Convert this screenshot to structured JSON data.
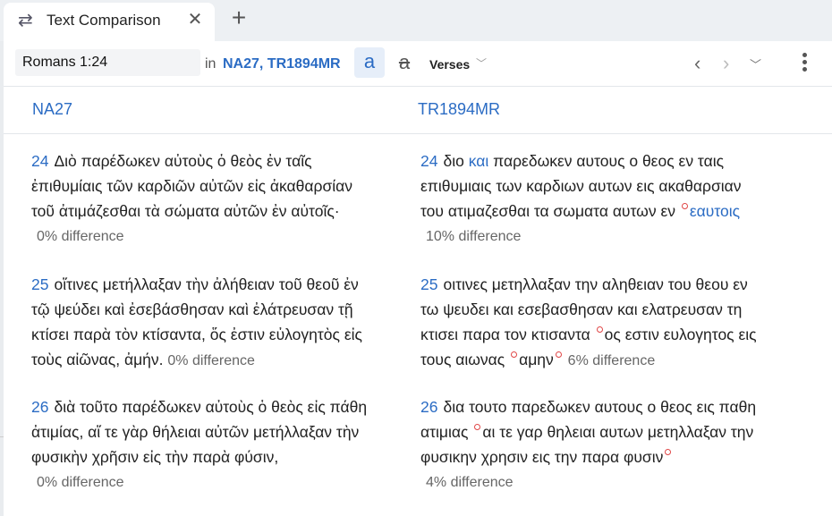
{
  "tab": {
    "title": "Text Comparison",
    "icon": "swap-arrows-icon",
    "close": "✕"
  },
  "new_tab": "+",
  "toolbar": {
    "reference": "Romans 1:24",
    "in_label": "in",
    "versions": "NA27, TR1894MR",
    "btn_a": "a",
    "btn_strike": "a",
    "mode": "Verses"
  },
  "columns": {
    "left": "NA27",
    "right": "TR1894MR"
  },
  "left": [
    {
      "num": "24",
      "lines": [
        "Διὸ παρέδωκεν αὐτοὺς ὁ θεὸς ἐν ταῖς",
        "ἐπιθυμίαις τῶν καρδιῶν αὐτῶν εἰς ἀκαθαρσίαν",
        "τοῦ ἀτιμάζεσθαι τὰ σώματα αὐτῶν ἐν αὐτοῖς·"
      ],
      "diff": "0% difference"
    },
    {
      "num": "25",
      "lines": [
        "οἵτινες μετήλλαξαν τὴν ἀλήθειαν τοῦ θεοῦ ἐν",
        "τῷ ψεύδει καὶ ἐσεβάσθησαν καὶ ἐλάτρευσαν τῇ",
        "κτίσει παρὰ τὸν κτίσαντα, ὅς ἐστιν εὐλογητὸς εἰς",
        "τοὺς αἰῶνας, ἀμήν."
      ],
      "diff": "0% difference"
    },
    {
      "num": "26",
      "lines": [
        "διὰ τοῦτο παρέδωκεν αὐτοὺς ὁ θεὸς εἰς πάθη",
        "ἀτιμίας, αἵ τε γὰρ θήλειαι αὐτῶν μετήλλαξαν τὴν",
        "φυσικὴν χρῆσιν εἰς τὴν παρὰ φύσιν,"
      ],
      "diff": "0% difference"
    }
  ],
  "right": {
    "v24": {
      "num": "24",
      "a": "διο",
      "var": "και",
      "b": "παρεδωκεν αυτους ο θεος εν ταις",
      "l2": "επιθυμιαις των καρδιων αυτων εις ακαθαρσιαν",
      "l3a": "του ατιμαζεσθαι τα σωματα αυτων εν",
      "l3var": "εαυτοις",
      "diff": "10% difference"
    },
    "v25": {
      "num": "25",
      "l1": "οιτινες μετηλλαξαν την αληθειαν του θεου εν",
      "l2": "τω ψευδει και εσεβασθησαν και ελατρευσαν τη",
      "l3a": "κτισει παρα τον κτισαντα",
      "l3b": "ος εστιν ευλογητος εις",
      "l4a": "τους αιωνας",
      "l4b": "αμην",
      "diff": "6% difference"
    },
    "v26": {
      "num": "26",
      "l1": "δια τουτο παρεδωκεν αυτους ο θεος εις παθη",
      "l2a": "ατιμιας",
      "l2b": "αι τε γαρ θηλειαι αυτων μετηλλαξαν την",
      "l3": "φυσικην χρησιν εις την παρα φυσιν",
      "diff": "4% difference"
    }
  }
}
